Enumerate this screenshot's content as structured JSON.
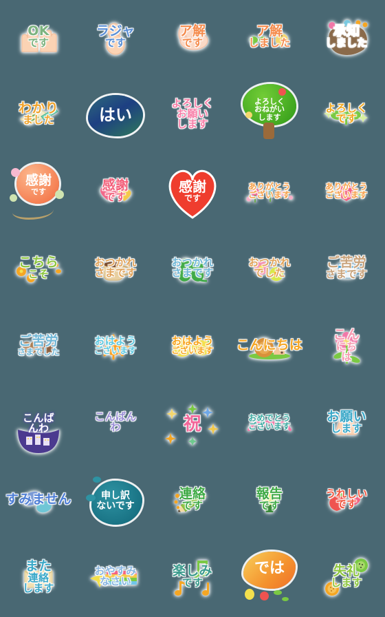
{
  "page": {
    "title": "Japanese Greeting Sticker Pack",
    "background_color": "#496873",
    "grid": {
      "columns": 5,
      "rows": 8,
      "total": 40
    }
  },
  "stickers": [
    {
      "id": 1,
      "text": "OKです",
      "lines": [
        "OK",
        "です"
      ],
      "color": "#7cb37f",
      "accent": "#f6c9a6",
      "art": "two-raised-hands-icon"
    },
    {
      "id": 2,
      "text": "ラジャです",
      "lines": [
        "ラジャ",
        "です"
      ],
      "color": "#5b8fd6",
      "accent": "#f7cdb0",
      "art": "thumbs-up-hand-icon"
    },
    {
      "id": 3,
      "text": "ア解です",
      "lines": [
        "ア解",
        "です"
      ],
      "color": "#f58b4c",
      "accent": "#fbd9c3",
      "art": "rabbit-icon"
    },
    {
      "id": 4,
      "text": "ア解しました",
      "lines": [
        "ア解",
        "しました"
      ],
      "color": "#f58b4c",
      "accent": "#8dc63f",
      "art": "sprouts-and-apple-icon"
    },
    {
      "id": 5,
      "text": "承知しました",
      "lines": [
        "承知",
        "しました"
      ],
      "color": "#ffffff",
      "accent": "#8a6a4a",
      "art": "brown-blob-with-flowers-icon"
    },
    {
      "id": 6,
      "text": "わかりました",
      "lines": [
        "わかり",
        "ました"
      ],
      "color": "#f0a32c",
      "accent": "#e8dfa8",
      "art": "notepad-and-pen-icon"
    },
    {
      "id": 7,
      "text": "はい",
      "lines": [
        "はい"
      ],
      "color": "#ffffff",
      "accent": "#2b4a7a",
      "art": "dark-blue-blob-icon"
    },
    {
      "id": 8,
      "text": "よろしくお願いします",
      "lines": [
        "よろしく",
        "お願い",
        "します"
      ],
      "color": "#f77fa8",
      "accent": "#f9a8c4",
      "art": "pink-sparkle-icon"
    },
    {
      "id": 9,
      "text": "よろしくおねがいします",
      "lines": [
        "よろしく",
        "おねがい",
        "します"
      ],
      "color": "#ffffff",
      "accent": "#49b02e",
      "art": "green-tree-icon"
    },
    {
      "id": 10,
      "text": "よろしくです",
      "lines": [
        "よろしく",
        "です"
      ],
      "color": "#f2a81f",
      "accent": "#7ac943",
      "art": "sprout-and-sparkles-icon"
    },
    {
      "id": 11,
      "text": "感謝です",
      "lines": [
        "感謝",
        "です"
      ],
      "color": "#ffffff",
      "accent": "#f4784f",
      "art": "orange-balloon-icon"
    },
    {
      "id": 12,
      "text": "感謝です",
      "lines": [
        "感謝",
        "です"
      ],
      "color": "#f25f7a",
      "accent": "#f3698a",
      "art": "two-hearts-icon"
    },
    {
      "id": 13,
      "text": "感謝です",
      "lines": [
        "感謝",
        "です"
      ],
      "color": "#ffffff",
      "accent": "#ef3d3d",
      "art": "red-heart-icon"
    },
    {
      "id": 14,
      "text": "ありがとうございます",
      "lines": [
        "ありがとう",
        "ございます"
      ],
      "color": "#f5a04a",
      "accent": "#f07fa0",
      "art": "flowers-icon"
    },
    {
      "id": 15,
      "text": "ありがとうございます",
      "lines": [
        "ありがとう",
        "ございます"
      ],
      "color": "#f5a04a",
      "accent": "#f4607f",
      "art": "heart-and-sparkle-icon"
    },
    {
      "id": 16,
      "text": "こちらこそ",
      "lines": [
        "こちら",
        "こそ"
      ],
      "color": "#8dc63f",
      "accent": "#f5a623",
      "art": "flower-confetti-icon"
    },
    {
      "id": 17,
      "text": "おつかれさまです",
      "lines": [
        "おつかれ",
        "さまです"
      ],
      "color": "#e0a35a",
      "accent": "#e8d3a0",
      "art": "coffee-mug-icon"
    },
    {
      "id": 18,
      "text": "おつかれさまです",
      "lines": [
        "おつかれ",
        "さまです"
      ],
      "color": "#6fb6d6",
      "accent": "#3faa46",
      "art": "four-leaf-clover-icon"
    },
    {
      "id": 19,
      "text": "おつかれでした",
      "lines": [
        "おつかれ",
        "でした"
      ],
      "color": "#e0a35a",
      "accent": "#f48fb1",
      "art": "two-flowers-icon"
    },
    {
      "id": 20,
      "text": "ご苦労さまです",
      "lines": [
        "ご苦労",
        "さまです"
      ],
      "color": "#c8a27a",
      "accent": "#4da6d8",
      "art": "blue-striped-cup-icon"
    },
    {
      "id": 21,
      "text": "ご苦労さまでした",
      "lines": [
        "ご苦労",
        "さまでした"
      ],
      "color": "#6fb6d6",
      "accent": "#a97b50",
      "art": "heart-cookies-icon"
    },
    {
      "id": 22,
      "text": "おはようございます",
      "lines": [
        "おはよう",
        "ございます"
      ],
      "color": "#5ec8e0",
      "accent": "#f79e1b",
      "art": "sun-icon"
    },
    {
      "id": 23,
      "text": "おはようございます",
      "lines": [
        "おはよう",
        "ございます"
      ],
      "color": "#f7a41b",
      "accent": "#f4e04d",
      "art": "lemon-icon"
    },
    {
      "id": 24,
      "text": "こんにちは",
      "lines": [
        "こんにちは"
      ],
      "color": "#f5a623",
      "accent": "#d9a441",
      "art": "snail-icon"
    },
    {
      "id": 25,
      "text": "こんにちは",
      "lines": [
        "こん",
        "にち",
        "は"
      ],
      "color": "#f79ab0",
      "accent": "#f277a8",
      "art": "pink-flower-icon"
    },
    {
      "id": 26,
      "text": "こんばんわ",
      "lines": [
        "こんば",
        "んわ"
      ],
      "color": "#ffffff",
      "accent": "#4b3a8f",
      "art": "night-town-icon"
    },
    {
      "id": 27,
      "text": "こんばんわ",
      "lines": [
        "こんばん",
        "わ"
      ],
      "color": "#9b8fd6",
      "accent": "#f2d14a",
      "art": "crescent-moon-icon"
    },
    {
      "id": 28,
      "text": "祝",
      "lines": [
        "祝"
      ],
      "color": "#f2679a",
      "accent": "#f2c94c",
      "art": "confetti-stars-icon"
    },
    {
      "id": 29,
      "text": "おめでとうございます",
      "lines": [
        "おめでとう",
        "ございます"
      ],
      "color": "#3aa8a0",
      "accent": "#f279a8",
      "art": "pink-ribbon-icon"
    },
    {
      "id": 30,
      "text": "お願いします",
      "lines": [
        "お願い",
        "します"
      ],
      "color": "#3aa8c8",
      "accent": "#fbd9bd",
      "art": "praying-hands-icon"
    },
    {
      "id": 31,
      "text": "すみません",
      "lines": [
        "すみません"
      ],
      "color": "#4f7fd6",
      "accent": "#6fb6cf",
      "art": "blue-pebbles-icon"
    },
    {
      "id": 32,
      "text": "申し訳ないです",
      "lines": [
        "申し訳",
        "ないです"
      ],
      "color": "#ffffff",
      "accent": "#1f7a8c",
      "art": "teal-blob-icon"
    },
    {
      "id": 33,
      "text": "連絡です",
      "lines": [
        "連絡",
        "です"
      ],
      "color": "#3faa46",
      "accent": "#8dc63f",
      "art": "green-pencil-icon"
    },
    {
      "id": 34,
      "text": "報告です",
      "lines": [
        "報告",
        "です"
      ],
      "color": "#3faa46",
      "accent": "#d9e84a",
      "art": "potted-bulb-plant-icon"
    },
    {
      "id": 35,
      "text": "うれしいです",
      "lines": [
        "うれしい",
        "です"
      ],
      "color": "#f2553d",
      "accent": "#f4607f",
      "art": "apple-and-hearts-icon"
    },
    {
      "id": 36,
      "text": "また連絡します",
      "lines": [
        "また",
        "連絡",
        "します"
      ],
      "color": "#3aa8c8",
      "accent": "#f3d9a0",
      "art": "envelope-icon"
    },
    {
      "id": 37,
      "text": "おやすみなさい",
      "lines": [
        "おやすみ",
        "なさい"
      ],
      "color": "#8ab6e0",
      "accent": "#f2e04a",
      "art": "shooting-star-rainbow-icon"
    },
    {
      "id": 38,
      "text": "楽しみです",
      "lines": [
        "楽しみ",
        "です"
      ],
      "color": "#3a9a8c",
      "accent": "#f5a623",
      "art": "music-notes-icon"
    },
    {
      "id": 39,
      "text": "では",
      "lines": [
        "では"
      ],
      "color": "#ffffff",
      "accent": "#f5a623",
      "art": "orange-mango-blob-icon"
    },
    {
      "id": 40,
      "text": "失礼します",
      "lines": [
        "失礼",
        "します"
      ],
      "color": "#8dc63f",
      "accent": "#7ac943",
      "art": "kiwi-and-orange-icon"
    }
  ]
}
